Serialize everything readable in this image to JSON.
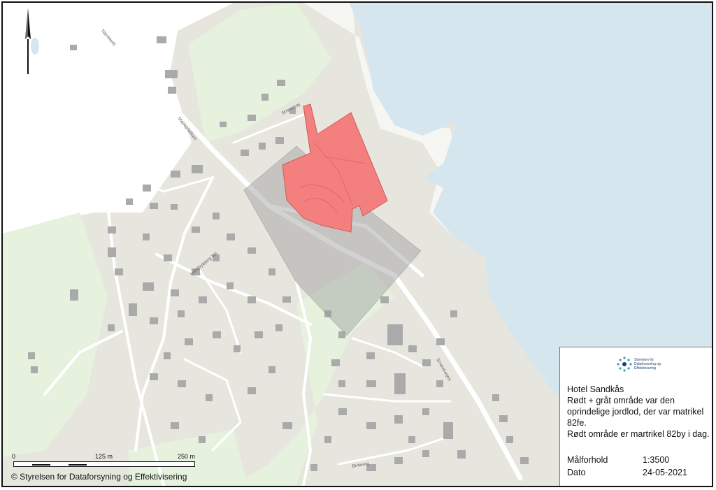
{
  "map": {
    "colors": {
      "water": "#d6e6ef",
      "land": "#e7e6de",
      "green": "#e6f2de",
      "building": "#aaaaaa",
      "road": "#ffffff",
      "red_parcel": "#f47f7f",
      "grey_area": "#9c9c9c"
    },
    "road_labels": [
      "Tibirkevej",
      "Stejlepladsen",
      "Strandvej",
      "Lundbybjerg Vej",
      "Strandvejen",
      "Birkevej"
    ]
  },
  "legend": {
    "logo_text": "Styrelsen for Dataforsyning og Effektivisering",
    "title": "Hotel Sandkås",
    "lines": [
      "Rødt + gråt område var den",
      "oprindelige jordlod, der var matrikel",
      "82fe.",
      "Rødt område er martrikel 82by i dag."
    ],
    "scale_label": "Målforhold",
    "scale_value": "1:3500",
    "date_label": "Dato",
    "date_value": "24-05-2021"
  },
  "scalebar": {
    "labels": [
      "0",
      "125 m",
      "250 m"
    ]
  },
  "north_arrow": {
    "icon": "north-arrow-icon"
  },
  "copyright": "© Styrelsen for Dataforsyning og Effektivisering"
}
